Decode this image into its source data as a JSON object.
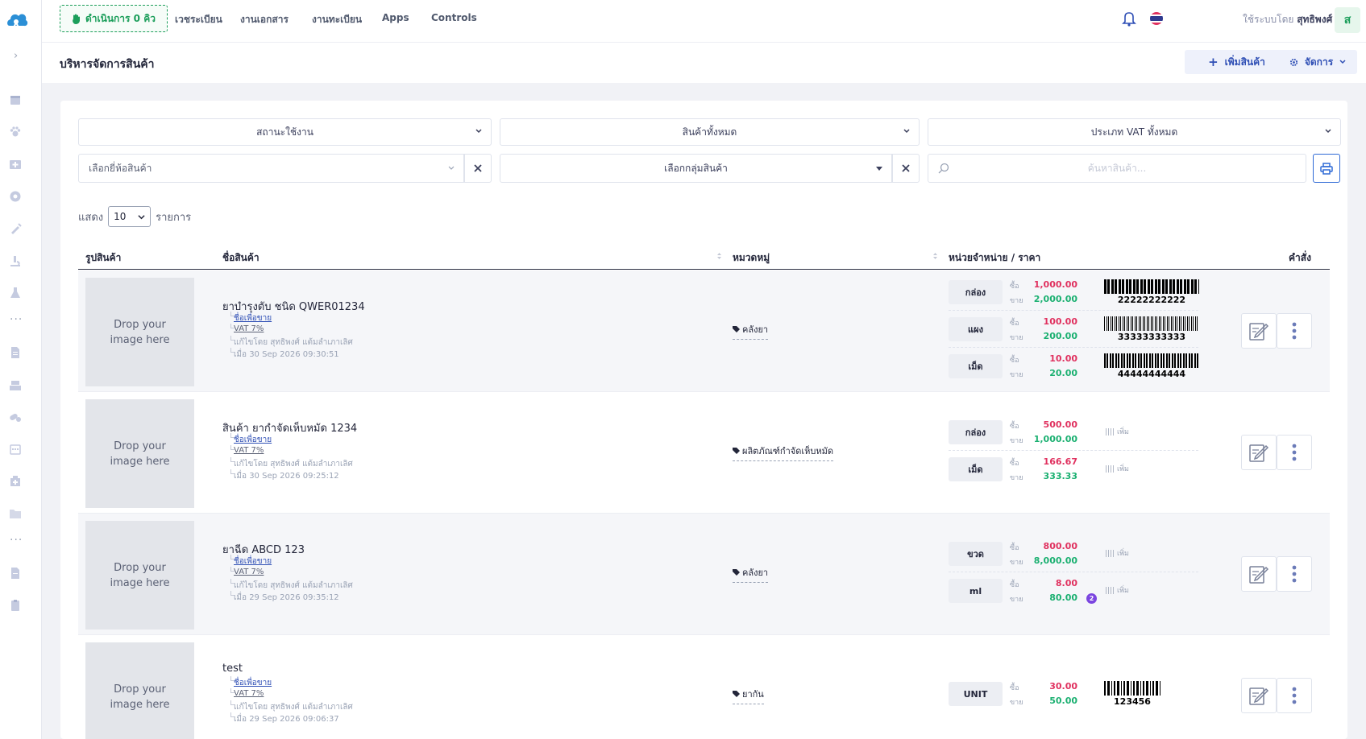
{
  "nav": {
    "queue_label": "ดำเนินการ 0 คิว",
    "items": [
      "เวชระเบียน",
      "งานเอกสาร",
      "งานทะเบียน",
      "Apps",
      "Controls"
    ],
    "user_prefix": "ใช้ระบบโดย",
    "user_name": "สุทธิพงศ์",
    "avatar_letter": "ส"
  },
  "header": {
    "title": "บริหารจัดการสินค้า",
    "add_label": "เพิ่มสินค้า",
    "manage_label": "จัดการ"
  },
  "filters": {
    "status": "สถานะใช้งาน",
    "product_type": "สินค้าทั้งหมด",
    "vat_type": "ประเภท VAT ทั้งหมด",
    "brand_placeholder": "เลือกยี่ห้อสินค้า",
    "group_placeholder": "เลือกกลุ่มสินค้า",
    "search_placeholder": "ค้นหาสินค้า..."
  },
  "paging": {
    "show_label": "แสดง",
    "page_size": "10",
    "items_label": "รายการ"
  },
  "table": {
    "headers": {
      "image": "รูปสินค้า",
      "name": "ชื่อสินค้า",
      "category": "หมวดหมู่",
      "units": "หน่วยจำหน่าย / ราคา",
      "actions": "คำสั่ง"
    },
    "dropzone_text": [
      "Drop your",
      "image here"
    ],
    "buy_label": "ซื้อ",
    "sell_label": "ขาย",
    "add_barcode_label": "เพิ่ม",
    "rows": [
      {
        "name": "ยาบำรุงตับ ชนิด QWER01234",
        "sale_name": "ชื่อเพื่อขาย",
        "vat": "VAT 7%",
        "edited_by": "แก้ไขโดย สุทธิพงศ์ แต้มลำเภาเลิศ",
        "edited_at": "เมื่อ 30 Sep 2026 09:30:51",
        "category": "คลังยา",
        "units": [
          {
            "unit": "กล่อง",
            "buy": "1,000.00",
            "sell": "2,000.00",
            "barcode": "22222222222"
          },
          {
            "unit": "แผง",
            "buy": "100.00",
            "sell": "200.00",
            "barcode": "33333333333"
          },
          {
            "unit": "เม็ด",
            "buy": "10.00",
            "sell": "20.00",
            "barcode": "44444444444"
          }
        ]
      },
      {
        "name": "สินค้า ยากำจัดเห็บหมัด 1234",
        "sale_name": "ชื่อเพื่อขาย",
        "vat": "VAT 7%",
        "edited_by": "แก้ไขโดย สุทธิพงศ์ แต้มลำเภาเลิศ",
        "edited_at": "เมื่อ 30 Sep 2026 09:25:12",
        "category": "ผลิตภัณฑ์กำจัดเห็บหมัด",
        "units": [
          {
            "unit": "กล่อง",
            "buy": "500.00",
            "sell": "1,000.00",
            "barcode": ""
          },
          {
            "unit": "เม็ด",
            "buy": "166.67",
            "sell": "333.33",
            "barcode": ""
          }
        ]
      },
      {
        "name": "ยาฉีด ABCD 123",
        "sale_name": "ชื่อเพื่อขาย",
        "vat": "VAT 7%",
        "edited_by": "แก้ไขโดย สุทธิพงศ์ แต้มลำเภาเลิศ",
        "edited_at": "เมื่อ 29 Sep 2026 09:35:12",
        "category": "คลังยา",
        "units": [
          {
            "unit": "ขวด",
            "buy": "800.00",
            "sell": "8,000.00",
            "barcode": ""
          },
          {
            "unit": "ml",
            "buy": "8.00",
            "sell": "80.00",
            "barcode": "",
            "badge": "2"
          }
        ]
      },
      {
        "name": "test",
        "sale_name": "ชื่อเพื่อขาย",
        "vat": "VAT 7%",
        "edited_by": "แก้ไขโดย สุทธิพงศ์ แต้มลำเภาเลิศ",
        "edited_at": "เมื่อ 29 Sep 2026 09:06:37",
        "category": "ยากัน",
        "units": [
          {
            "unit": "UNIT",
            "buy": "30.00",
            "sell": "50.00",
            "barcode": "123456"
          }
        ]
      }
    ]
  },
  "colors": {
    "primary": "#2f4fb5",
    "success": "#1bb071",
    "danger": "#e0315f",
    "queue": "#1b9e5a"
  }
}
